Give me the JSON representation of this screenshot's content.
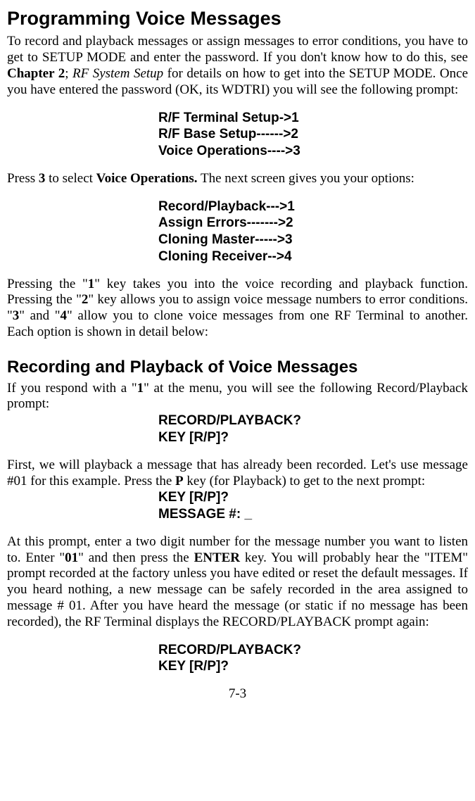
{
  "heading1": "Programming Voice Messages",
  "para1_a": "To record and playback messages or assign messages to error conditions, you have to get to SETUP MODE and enter the password. If you don't know how to do this, see ",
  "para1_b": "Chapter 2",
  "para1_c": "; ",
  "para1_d": "RF System Setup",
  "para1_e": " for details on how to get into the SETUP MODE.  Once you have entered the password (OK, its WDTRI) you will see the following prompt:",
  "menu1": "R/F Terminal Setup->1\nR/F Base Setup------>2\nVoice Operations---->3",
  "para2_a": "Press ",
  "para2_b": "3",
  "para2_c": " to select ",
  "para2_d": "Voice Operations.",
  "para2_e": " The next screen gives you your options:",
  "menu2": "Record/Playback--->1\nAssign Errors------->2\nCloning Master----->3\nCloning Receiver-->4",
  "para3_a": "Pressing the \"",
  "para3_b": "1",
  "para3_c": "\" key takes you into the voice recording and playback function. Pressing the \"",
  "para3_d": "2",
  "para3_e": "\" key allows you to assign voice message numbers to error conditions. \"",
  "para3_f": "3",
  "para3_g": "\" and \"",
  "para3_h": "4",
  "para3_i": "\" allow you to clone voice messages from one RF Terminal to another.  Each option is shown in detail below:",
  "heading2": "Recording and Playback of Voice Messages",
  "para4_a": "If you respond with a \"",
  "para4_b": "1",
  "para4_c": "\" at the menu, you will see the following Record/Playback prompt:",
  "menu3": "RECORD/PLAYBACK?\nKEY [R/P]?",
  "para5_a": "First, we will playback a message that has already been recorded. Let's use message #01 for this example. Press the ",
  "para5_b": "P",
  "para5_c": " key (for Playback) to get to the next prompt:",
  "menu4": "KEY [R/P]?\nMESSAGE #: _",
  "para6_a": "At this prompt, enter a two digit number for the message number you want to listen to.  Enter \"",
  "para6_b": "01",
  "para6_c": "\" and then press the ",
  "para6_d": "ENTER",
  "para6_e": " key. You will probably hear the \"ITEM\" prompt recorded at the factory unless you have edited or reset the default messages. If you heard nothing, a new message can be safely recorded in the area assigned to message # 01. After you have heard the message (or static if no message has been recorded), the RF Terminal displays the RECORD/PLAYBACK prompt again:",
  "menu5": "RECORD/PLAYBACK?\nKEY [R/P]?",
  "pagenum": "7-3"
}
